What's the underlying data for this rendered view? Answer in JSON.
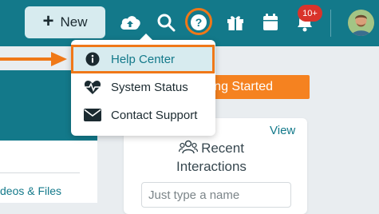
{
  "topbar": {
    "new_button_label": "New",
    "icons": [
      "cloud-upload-icon",
      "search-icon",
      "help-icon",
      "gift-icon",
      "calendar-icon",
      "bell-icon"
    ],
    "notification_count": "10+"
  },
  "dropdown": {
    "items": [
      {
        "label": "Help Center",
        "icon": "info-icon"
      },
      {
        "label": "System Status",
        "icon": "heartbeat-icon"
      },
      {
        "label": "Contact Support",
        "icon": "envelope-icon"
      }
    ]
  },
  "banner": {
    "getting_started_label": "ng Started"
  },
  "sidebar": {
    "link_label": "deos & Files"
  },
  "card": {
    "view_label": "View",
    "title_line1": "Recent",
    "title_line2": "Interactions",
    "input_placeholder": "Just type a name"
  },
  "colors": {
    "brand_teal": "#13798a",
    "accent_orange": "#f07818",
    "badge_red": "#d9332b",
    "menu_highlight": "#d7ebef"
  }
}
